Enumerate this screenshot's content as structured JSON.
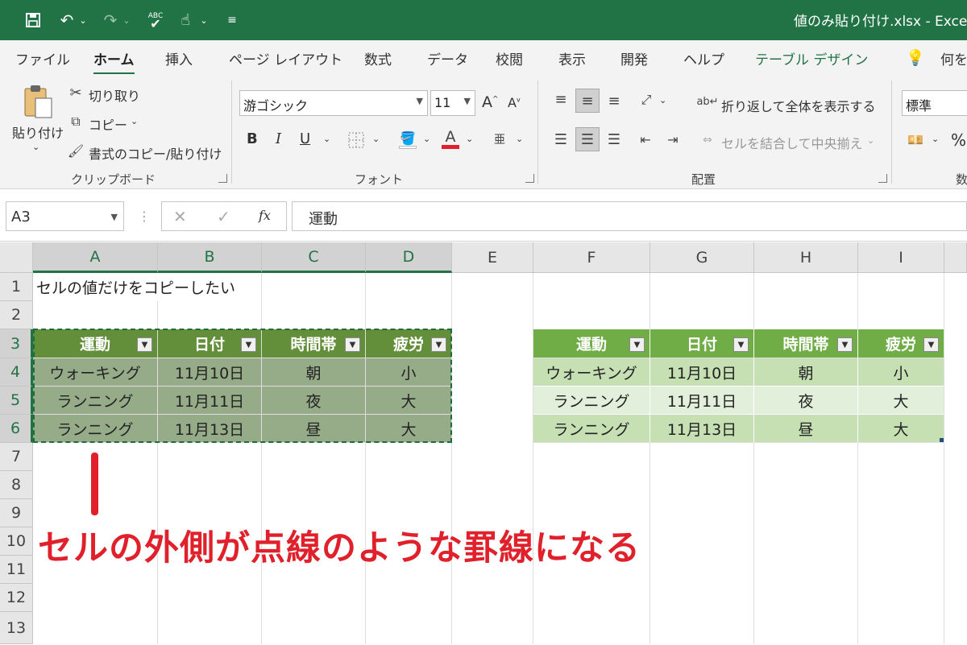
{
  "titlebar": {
    "filename": "値のみ貼り付け.xlsx  -  Exce",
    "qat_undo": "↶",
    "qat_redo": "↷"
  },
  "tabs": [
    "ファイル",
    "ホーム",
    "挿入",
    "ページ レイアウト",
    "数式",
    "データ",
    "校閲",
    "表示",
    "開発",
    "ヘルプ",
    "テーブル デザイン"
  ],
  "tell_me": "何をし",
  "clipboard": {
    "paste": "貼り付け",
    "cut": "切り取り",
    "copy": "コピー",
    "format_painter": "書式のコピー/貼り付け",
    "label": "クリップボード"
  },
  "font": {
    "name": "游ゴシック",
    "size": "11",
    "label": "フォント",
    "bold": "B",
    "italic": "I",
    "underline": "U"
  },
  "alignment": {
    "wrap": "折り返して全体を表示する",
    "merge": "セルを結合して中央揃え",
    "label": "配置"
  },
  "number": {
    "format": "標準",
    "label": "数",
    "percent": "%"
  },
  "formula_bar": {
    "name_box": "A3",
    "content": "運動",
    "fx": "fx"
  },
  "columns": [
    "A",
    "B",
    "C",
    "D",
    "E",
    "F",
    "G",
    "H",
    "I"
  ],
  "rows": [
    "1",
    "2",
    "3",
    "4",
    "5",
    "6",
    "7",
    "8",
    "9",
    "10",
    "11",
    "12",
    "13"
  ],
  "a1": "セルの値だけをコピーしたい",
  "left_table": {
    "headers": [
      "運動",
      "日付",
      "時間帯",
      "疲労"
    ],
    "rows": [
      [
        "ウォーキング",
        "11月10日",
        "朝",
        "小"
      ],
      [
        "ランニング",
        "11月11日",
        "夜",
        "大"
      ],
      [
        "ランニング",
        "11月13日",
        "昼",
        "大"
      ]
    ]
  },
  "right_table": {
    "headers": [
      "運動",
      "日付",
      "時間帯",
      "疲労"
    ],
    "rows": [
      [
        "ウォーキング",
        "11月10日",
        "朝",
        "小"
      ],
      [
        "ランニング",
        "11月11日",
        "夜",
        "大"
      ],
      [
        "ランニング",
        "11月13日",
        "昼",
        "大"
      ]
    ]
  },
  "annotation": "セルの外側が点線のような罫線になる",
  "colors": {
    "excel_green": "#217346",
    "table_header": "#70ad47",
    "annotation_red": "#e0202a"
  }
}
